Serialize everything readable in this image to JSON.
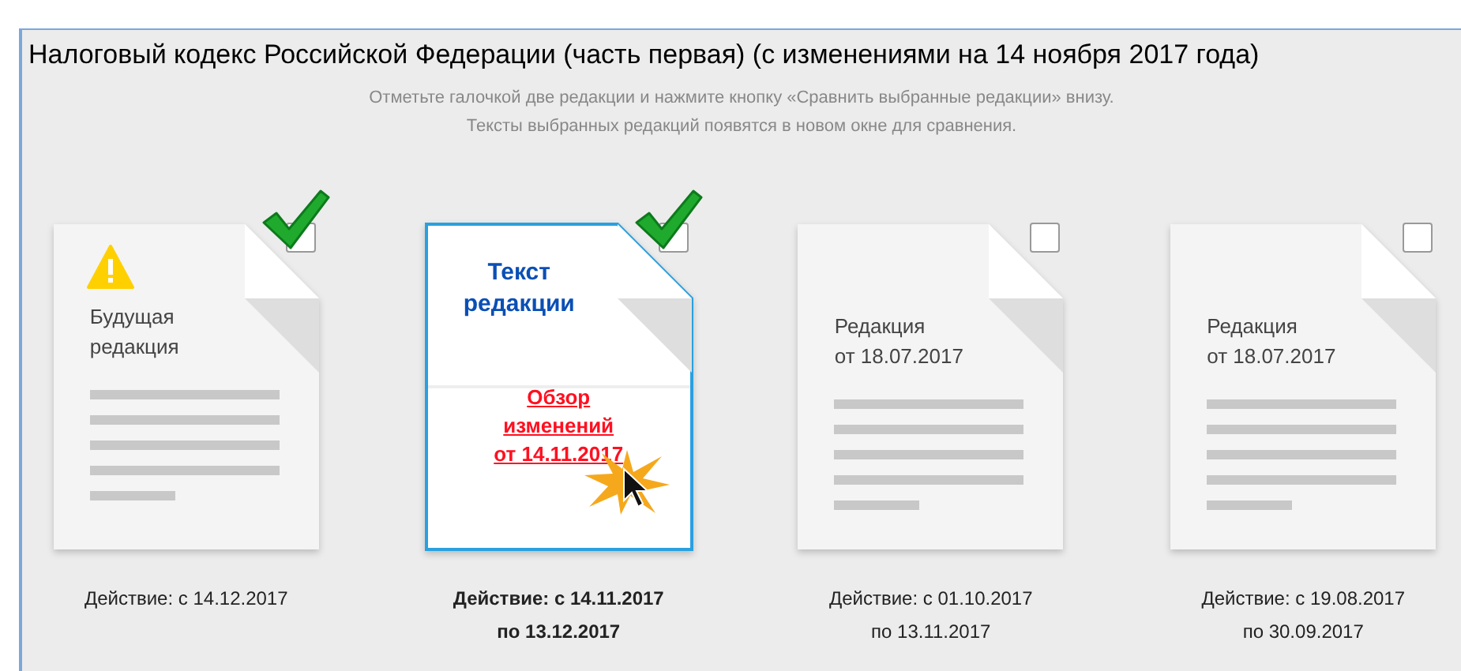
{
  "title": "Налоговый кодекс Российской Федерации (часть первая) (с изменениями на 14 ноября 2017 года)",
  "instructions": [
    "Отметьте галочкой две редакции и нажмите кнопку «Сравнить выбранные редакции» внизу.",
    "Тексты выбранных редакций появятся в новом окне для сравнения."
  ],
  "editions": [
    {
      "kind": "future",
      "title": [
        "Будущая",
        "редакция"
      ],
      "checked": true,
      "selected": false,
      "period": [
        "Действие: с 14.12.2017"
      ]
    },
    {
      "kind": "current",
      "title": [
        "Текст",
        "редакции"
      ],
      "link": [
        "Обзор",
        "изменений",
        "от 14.11.2017"
      ],
      "checked": true,
      "selected": true,
      "period": [
        "Действие: с 14.11.2017",
        "по 13.12.2017"
      ]
    },
    {
      "kind": "past",
      "title": [
        "Редакция",
        "от 18.07.2017"
      ],
      "checked": false,
      "selected": false,
      "period": [
        "Действие: с 01.10.2017",
        "по 13.11.2017"
      ]
    },
    {
      "kind": "past",
      "title": [
        "Редакция",
        "от 18.07.2017"
      ],
      "checked": false,
      "selected": false,
      "period": [
        "Действие: с 19.08.2017",
        "по 30.09.2017"
      ]
    }
  ]
}
